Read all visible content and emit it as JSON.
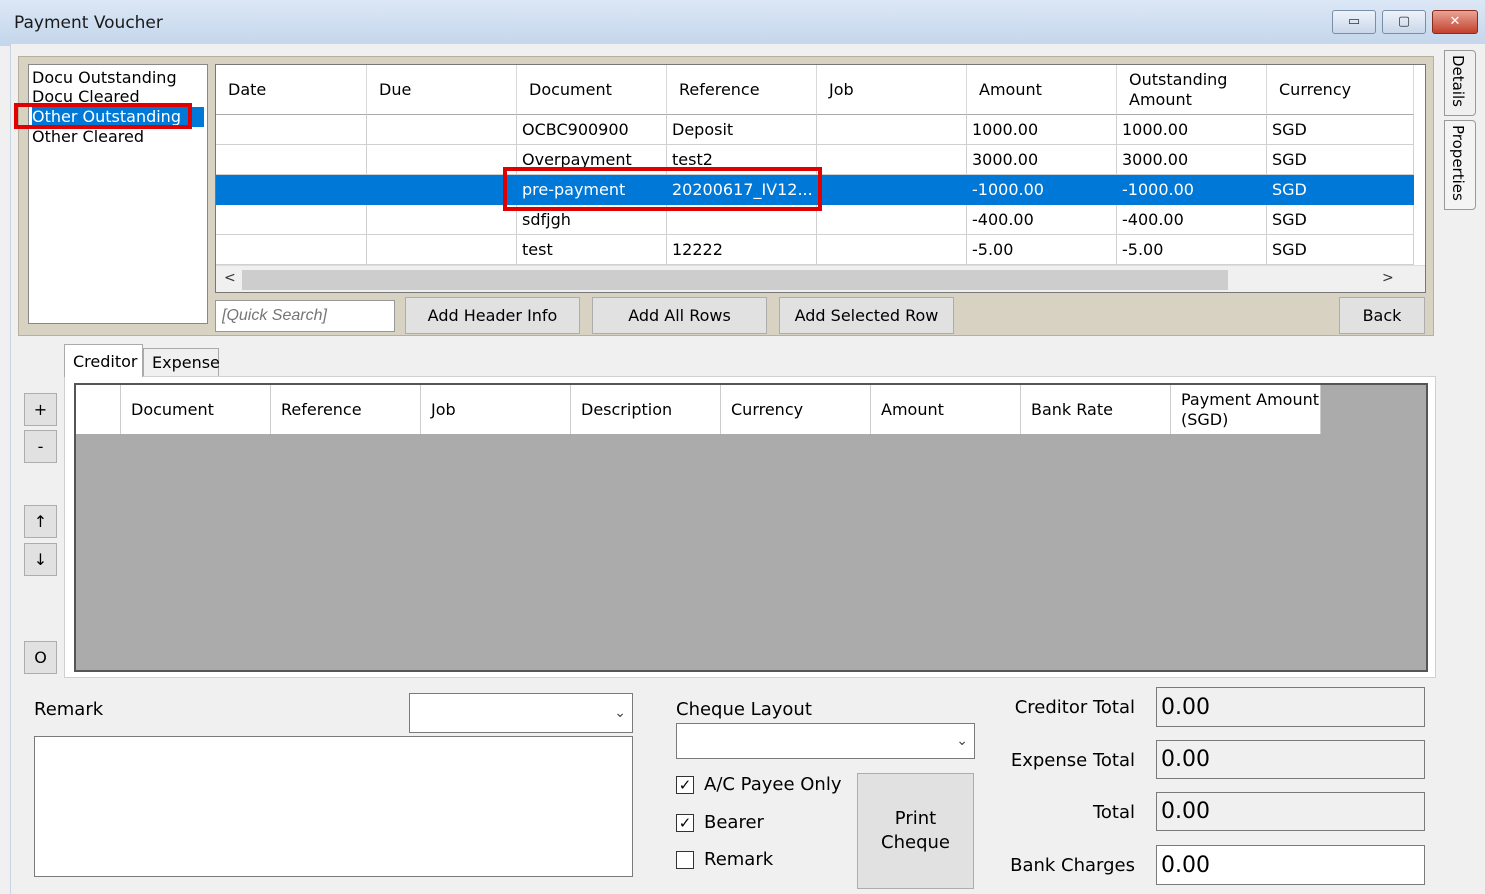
{
  "window": {
    "title": "Payment Voucher",
    "min_glyph": "▭",
    "max_glyph": "▢",
    "close_glyph": "✕"
  },
  "side_tabs": [
    "Details",
    "Properties"
  ],
  "categories": [
    {
      "label": "Docu Outstanding"
    },
    {
      "label": "Docu Cleared"
    },
    {
      "label": "Other Outstanding"
    },
    {
      "label": "Other Cleared"
    }
  ],
  "upper_grid": {
    "headers": [
      "Date",
      "Due",
      "Document",
      "Reference",
      "Job",
      "Amount",
      "Outstanding Amount",
      "Currency"
    ],
    "rows": [
      {
        "date": "",
        "due": "",
        "document": "OCBC900900",
        "reference": "Deposit",
        "job": "",
        "amount": "1000.00",
        "outstanding": "1000.00",
        "currency": "SGD"
      },
      {
        "date": "",
        "due": "",
        "document": "Overpayment",
        "reference": "test2",
        "job": "",
        "amount": "3000.00",
        "outstanding": "3000.00",
        "currency": "SGD"
      },
      {
        "date": "",
        "due": "",
        "document": "pre-payment",
        "reference": "20200617_IV12...",
        "job": "",
        "amount": "-1000.00",
        "outstanding": "-1000.00",
        "currency": "SGD"
      },
      {
        "date": "",
        "due": "",
        "document": "sdfjgh",
        "reference": "",
        "job": "",
        "amount": "-400.00",
        "outstanding": "-400.00",
        "currency": "SGD"
      },
      {
        "date": "",
        "due": "",
        "document": "test",
        "reference": "12222",
        "job": "",
        "amount": "-5.00",
        "outstanding": "-5.00",
        "currency": "SGD"
      }
    ],
    "selected_row_index": 2,
    "up_arrow": "^",
    "down_arrow": "v",
    "left_arrow": "<",
    "right_arrow": ">"
  },
  "toolbar": {
    "quick_search_placeholder": "[Quick Search]",
    "add_header_info": "Add Header Info",
    "add_all_rows": "Add All Rows",
    "add_selected_row": "Add Selected Row",
    "back": "Back"
  },
  "tabs": {
    "creditor": "Creditor",
    "expense": "Expense"
  },
  "lower_grid": {
    "headers": [
      "Document",
      "Reference",
      "Job",
      "Description",
      "Currency",
      "Amount",
      "Bank Rate",
      "Payment Amount (SGD)"
    ]
  },
  "side_buttons": {
    "add": "+",
    "remove": "-",
    "up": "↑",
    "down": "↓",
    "other": "O"
  },
  "bottom": {
    "remark_label": "Remark",
    "cheque_layout_label": "Cheque Layout",
    "ac_payee_only": {
      "label": "A/C Payee Only",
      "checked": true
    },
    "bearer": {
      "label": "Bearer",
      "checked": true
    },
    "remark_check": {
      "label": "Remark",
      "checked": false
    },
    "print_cheque": "Print Cheque",
    "combo_arrow": "⌄",
    "check_mark": "✓",
    "totals": [
      {
        "label": "Creditor Total",
        "value": "0.00"
      },
      {
        "label": "Expense Total",
        "value": "0.00"
      },
      {
        "label": "Total",
        "value": "0.00"
      },
      {
        "label": "Bank Charges",
        "value": "0.00"
      }
    ]
  },
  "colors": {
    "selection": "#0078d7",
    "highlight": "#e00000"
  }
}
